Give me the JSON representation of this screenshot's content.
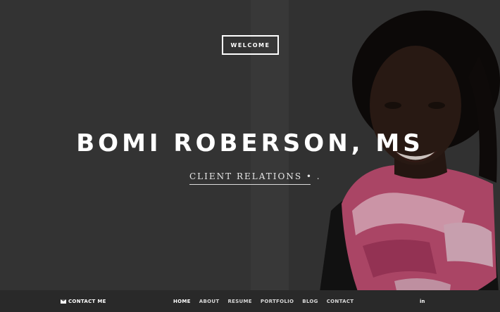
{
  "hero": {
    "welcome_label": "WELCOME",
    "name": "BOMI ROBERSON, MS",
    "subtitle": "CLIENT RELATIONS • ."
  },
  "footer": {
    "contact_me_label": "CONTACT ME",
    "contact_icon": "envelope-icon",
    "nav": [
      {
        "label": "HOME",
        "active": true
      },
      {
        "label": "ABOUT",
        "active": false
      },
      {
        "label": "RESUME",
        "active": false
      },
      {
        "label": "PORTFOLIO",
        "active": false
      },
      {
        "label": "BLOG",
        "active": false
      },
      {
        "label": "CONTACT",
        "active": false
      }
    ],
    "social_label": "in",
    "social_icon": "linkedin-icon"
  },
  "colors": {
    "background": "#353535",
    "text": "#ffffff",
    "scarf_pink": "#e0527f"
  }
}
